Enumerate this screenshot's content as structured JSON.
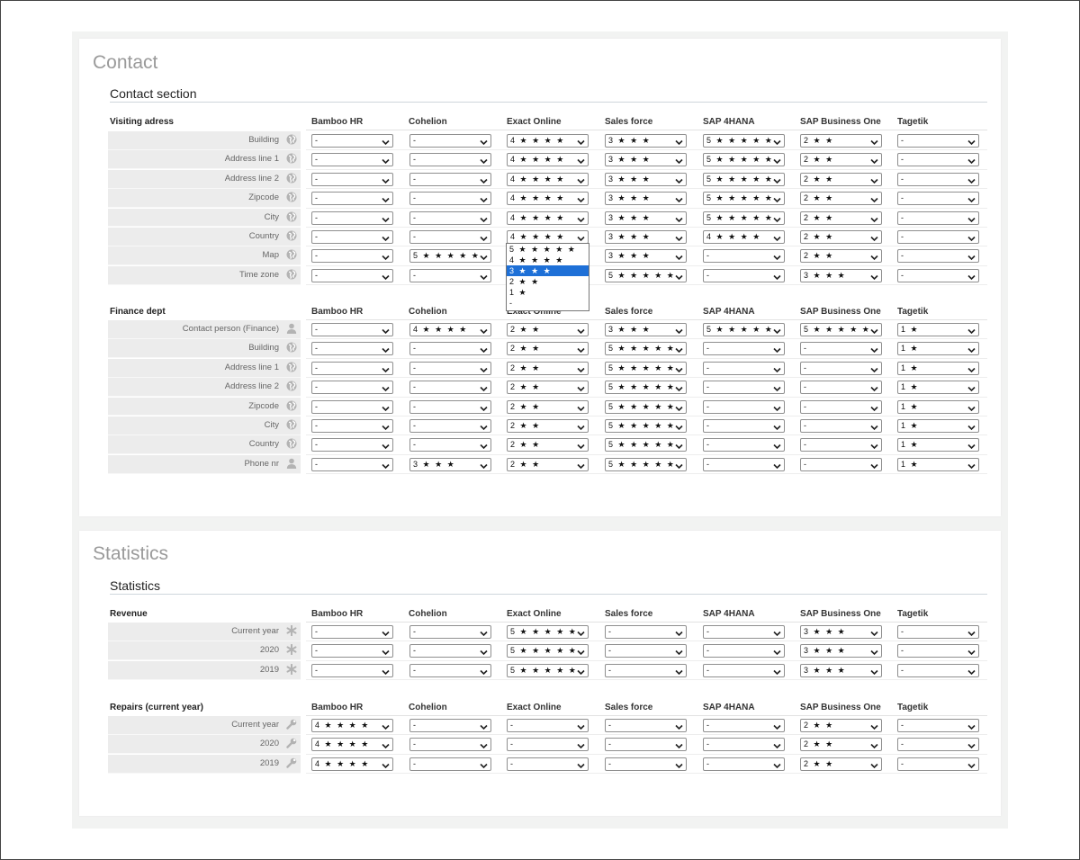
{
  "columns": [
    "Bamboo HR",
    "Cohelion",
    "Exact Online",
    "Sales force",
    "SAP 4HANA",
    "SAP Business One",
    "Tagetik"
  ],
  "panels": [
    {
      "title": "Contact",
      "section_title": "Contact section",
      "groups": [
        {
          "title": "Visiting adress",
          "rows": [
            {
              "label": "Building",
              "icon": "globe-icon",
              "values": [
                "-",
                "-",
                "4 ★ ★ ★ ★",
                "3 ★ ★ ★",
                "5 ★ ★ ★ ★ ★",
                "2 ★ ★",
                "-"
              ]
            },
            {
              "label": "Address line 1",
              "icon": "globe-icon",
              "values": [
                "-",
                "-",
                "4 ★ ★ ★ ★",
                "3 ★ ★ ★",
                "5 ★ ★ ★ ★ ★",
                "2 ★ ★",
                "-"
              ]
            },
            {
              "label": "Address line 2",
              "icon": "globe-icon",
              "values": [
                "-",
                "-",
                "4 ★ ★ ★ ★",
                "3 ★ ★ ★",
                "5 ★ ★ ★ ★ ★",
                "2 ★ ★",
                "-"
              ]
            },
            {
              "label": "Zipcode",
              "icon": "globe-icon",
              "values": [
                "-",
                "-",
                "4 ★ ★ ★ ★",
                "3 ★ ★ ★",
                "5 ★ ★ ★ ★ ★",
                "2 ★ ★",
                "-"
              ]
            },
            {
              "label": "City",
              "icon": "globe-icon",
              "values": [
                "-",
                "-",
                "4 ★ ★ ★ ★",
                "3 ★ ★ ★",
                "5 ★ ★ ★ ★ ★",
                "2 ★ ★",
                "-"
              ]
            },
            {
              "label": "Country",
              "icon": "globe-icon",
              "values": [
                "-",
                "-",
                "4 ★ ★ ★ ★",
                "3 ★ ★ ★",
                "4 ★ ★ ★ ★",
                "2 ★ ★",
                "-"
              ]
            },
            {
              "label": "Map",
              "icon": "globe-icon",
              "values": [
                "-",
                "5 ★ ★ ★ ★ ★",
                "",
                "3 ★ ★ ★",
                "-",
                "2 ★ ★",
                "-"
              ]
            },
            {
              "label": "Time zone",
              "icon": "globe-icon",
              "values": [
                "-",
                "-",
                "",
                "5 ★ ★ ★ ★ ★",
                "-",
                "3 ★ ★ ★",
                "-"
              ]
            }
          ]
        },
        {
          "title": "Finance dept",
          "rows": [
            {
              "label": "Contact person (Finance)",
              "icon": "person-icon",
              "values": [
                "-",
                "4 ★ ★ ★ ★",
                "2 ★ ★",
                "3 ★ ★ ★",
                "5 ★ ★ ★ ★ ★",
                "5 ★ ★ ★ ★ ★",
                "1 ★"
              ]
            },
            {
              "label": "Building",
              "icon": "globe-icon",
              "values": [
                "-",
                "-",
                "2 ★ ★",
                "5 ★ ★ ★ ★ ★",
                "-",
                "-",
                "1 ★"
              ]
            },
            {
              "label": "Address line 1",
              "icon": "globe-icon",
              "values": [
                "-",
                "-",
                "2 ★ ★",
                "5 ★ ★ ★ ★ ★",
                "-",
                "-",
                "1 ★"
              ]
            },
            {
              "label": "Address line 2",
              "icon": "globe-icon",
              "values": [
                "-",
                "-",
                "2 ★ ★",
                "5 ★ ★ ★ ★ ★",
                "-",
                "-",
                "1 ★"
              ]
            },
            {
              "label": "Zipcode",
              "icon": "globe-icon",
              "values": [
                "-",
                "-",
                "2 ★ ★",
                "5 ★ ★ ★ ★ ★",
                "-",
                "-",
                "1 ★"
              ]
            },
            {
              "label": "City",
              "icon": "globe-icon",
              "values": [
                "-",
                "-",
                "2 ★ ★",
                "5 ★ ★ ★ ★ ★",
                "-",
                "-",
                "1 ★"
              ]
            },
            {
              "label": "Country",
              "icon": "globe-icon",
              "values": [
                "-",
                "-",
                "2 ★ ★",
                "5 ★ ★ ★ ★ ★",
                "-",
                "-",
                "1 ★"
              ]
            },
            {
              "label": "Phone nr",
              "icon": "person-icon",
              "values": [
                "-",
                "3 ★ ★ ★",
                "2 ★ ★",
                "5 ★ ★ ★ ★ ★",
                "-",
                "-",
                "1 ★"
              ]
            }
          ]
        }
      ]
    },
    {
      "title": "Statistics",
      "section_title": "Statistics",
      "groups": [
        {
          "title": "Revenue",
          "rows": [
            {
              "label": "Current year",
              "icon": "asterisk-icon",
              "values": [
                "-",
                "-",
                "5 ★ ★ ★ ★ ★",
                "-",
                "-",
                "3 ★ ★ ★",
                "-"
              ]
            },
            {
              "label": "2020",
              "icon": "asterisk-icon",
              "values": [
                "-",
                "-",
                "5 ★ ★ ★ ★ ★",
                "-",
                "-",
                "3 ★ ★ ★",
                "-"
              ]
            },
            {
              "label": "2019",
              "icon": "asterisk-icon",
              "values": [
                "-",
                "-",
                "5 ★ ★ ★ ★ ★",
                "-",
                "-",
                "3 ★ ★ ★",
                "-"
              ]
            }
          ]
        },
        {
          "title": "Repairs (current year)",
          "rows": [
            {
              "label": "Current year",
              "icon": "wrench-icon",
              "values": [
                "4 ★ ★ ★ ★",
                "-",
                "-",
                "-",
                "-",
                "2 ★ ★",
                "-"
              ]
            },
            {
              "label": "2020",
              "icon": "wrench-icon",
              "values": [
                "4 ★ ★ ★ ★",
                "-",
                "-",
                "-",
                "-",
                "2 ★ ★",
                "-"
              ]
            },
            {
              "label": "2019",
              "icon": "wrench-icon",
              "values": [
                "4 ★ ★ ★ ★",
                "-",
                "-",
                "-",
                "-",
                "2 ★ ★",
                "-"
              ]
            }
          ]
        }
      ]
    }
  ],
  "open_dropdown": {
    "column": "Exact Online",
    "options": [
      "5 ★ ★ ★ ★ ★",
      "4 ★ ★ ★ ★",
      "3 ★ ★ ★",
      "2 ★ ★",
      "1 ★",
      "-"
    ],
    "highlighted": "3 ★ ★ ★"
  },
  "colors": {
    "highlight": "#1e70d7",
    "label_bg": "#ececec",
    "panel_bg": "#ffffff",
    "page_bg": "#f2f3f2"
  }
}
